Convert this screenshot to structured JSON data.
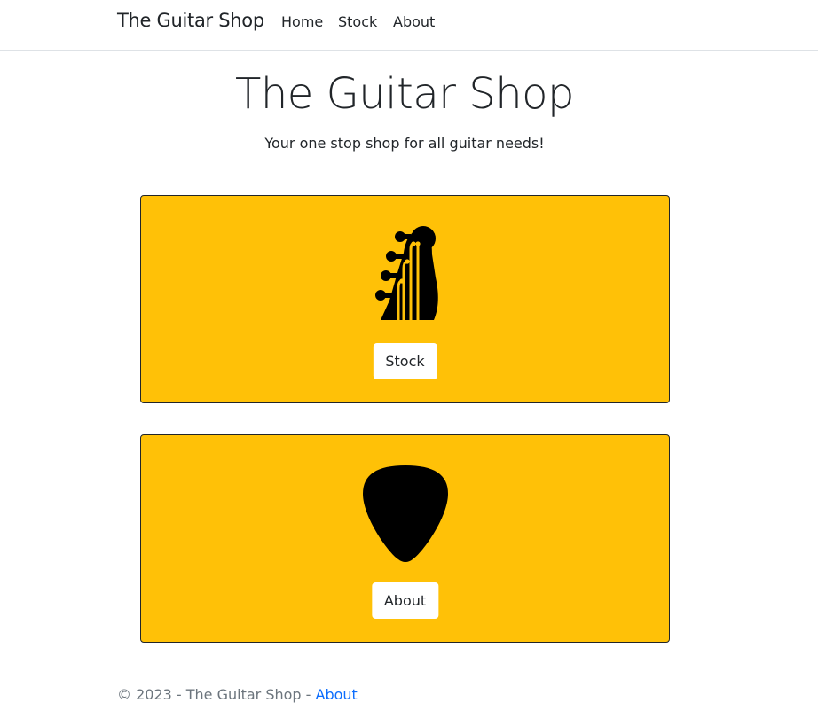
{
  "navbar": {
    "brand": "The Guitar Shop",
    "links": [
      {
        "label": "Home"
      },
      {
        "label": "Stock"
      },
      {
        "label": "About"
      }
    ]
  },
  "hero": {
    "title": "The Guitar Shop",
    "subtitle": "Your one stop shop for all guitar needs!"
  },
  "cards": [
    {
      "icon": "guitar-headstock-icon",
      "button_label": "Stock"
    },
    {
      "icon": "guitar-pick-icon",
      "button_label": "About"
    }
  ],
  "footer": {
    "text": "© 2023 - The Guitar Shop - ",
    "link_label": "About"
  },
  "colors": {
    "card_background": "#ffc107",
    "link": "#0d6efd",
    "footer_text": "#6c757d"
  }
}
